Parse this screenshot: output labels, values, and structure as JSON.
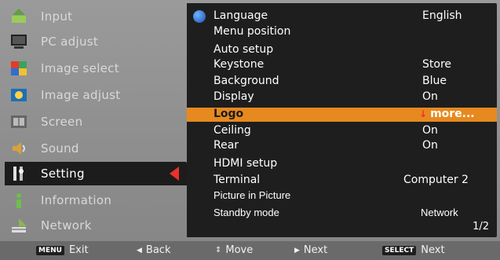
{
  "left_menu": [
    {
      "label": "Input",
      "icon": "input-icon"
    },
    {
      "label": "PC adjust",
      "icon": "pc-adjust-icon"
    },
    {
      "label": "Image select",
      "icon": "image-select-icon"
    },
    {
      "label": "Image adjust",
      "icon": "image-adjust-icon"
    },
    {
      "label": "Screen",
      "icon": "screen-icon"
    },
    {
      "label": "Sound",
      "icon": "sound-icon"
    },
    {
      "label": "Setting",
      "icon": "setting-icon"
    },
    {
      "label": "Information",
      "icon": "information-icon"
    },
    {
      "label": "Network",
      "icon": "network-icon"
    }
  ],
  "selected_menu": "Setting",
  "settings": [
    {
      "name": "Language",
      "value": "English"
    },
    {
      "name": "Menu position",
      "value": ""
    },
    {
      "name": "Auto setup",
      "value": ""
    },
    {
      "name": "Keystone",
      "value": "Store"
    },
    {
      "name": "Background",
      "value": "Blue"
    },
    {
      "name": "Display",
      "value": "On"
    },
    {
      "name": "Logo",
      "value": "more..."
    },
    {
      "name": "Ceiling",
      "value": "On"
    },
    {
      "name": "Rear",
      "value": "On"
    },
    {
      "name": "HDMI setup",
      "value": ""
    },
    {
      "name": "Terminal",
      "value": "Computer 2"
    },
    {
      "name": "Picture in Picture",
      "value": ""
    },
    {
      "name": "Standby mode",
      "value": "Network"
    }
  ],
  "page_indicator": "1/2",
  "bottom_bar": {
    "exit_badge": "MENU",
    "exit_label": "Exit",
    "back_label": "Back",
    "move_label": "Move",
    "next_label": "Next",
    "select_badge": "SELECT",
    "select_next_label": "Next"
  },
  "colors": {
    "highlight": "#e6891f",
    "selection_arrow": "#e8322b",
    "panel": "#1e1e1e"
  }
}
